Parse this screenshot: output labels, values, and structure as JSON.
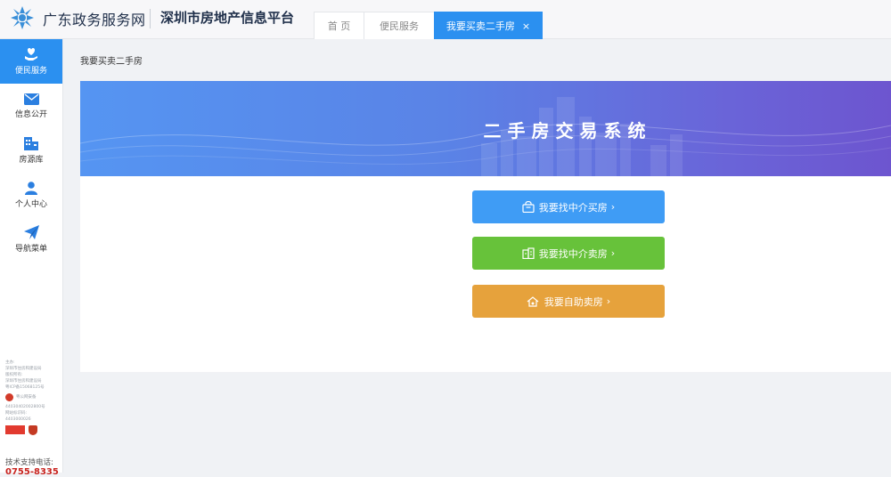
{
  "header": {
    "site_name": "广东政务服务网",
    "platform_name": "深圳市房地产信息平台",
    "tabs": [
      {
        "label": "首 页"
      },
      {
        "label": "便民服务"
      },
      {
        "label": "我要买卖二手房",
        "active": true
      }
    ],
    "close_glyph": "×"
  },
  "sidebar": {
    "items": [
      {
        "label": "便民服务",
        "icon": "heart-hand-icon",
        "active": true
      },
      {
        "label": "信息公开",
        "icon": "envelope-icon"
      },
      {
        "label": "房源库",
        "icon": "building-icon"
      },
      {
        "label": "个人中心",
        "icon": "user-icon"
      },
      {
        "label": "导航菜单",
        "icon": "paper-plane-icon"
      }
    ],
    "footer": {
      "lines": [
        "主办:",
        "深圳市住房和建设局",
        "版权所有:",
        "深圳市住房和建设局",
        "粤ICP备15068125号"
      ],
      "police_label": "粤公网安备",
      "record_lines": [
        "44030402002800号",
        "网站标识码:",
        "4403000026"
      ],
      "support_label": "技术支持电话:",
      "support_phone": "0755-8335"
    }
  },
  "main": {
    "breadcrumb": "我要买卖二手房",
    "banner_title": "二手房交易系统",
    "buttons": [
      {
        "label": "我要找中介买房",
        "color": "#3f9cf5"
      },
      {
        "label": "我要找中介卖房",
        "color": "#67c23a"
      },
      {
        "label": "我要自助卖房",
        "color": "#e6a23c"
      }
    ],
    "chevron": "›"
  },
  "colors": {
    "accent": "#2b90f0",
    "support_phone": "#c8231e"
  }
}
